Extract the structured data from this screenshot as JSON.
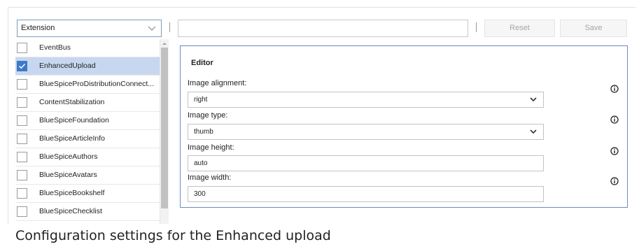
{
  "toolbar": {
    "filter_value": "Extension",
    "search_value": "",
    "reset_label": "Reset",
    "save_label": "Save"
  },
  "extensions": [
    {
      "label": "EventBus",
      "checked": false
    },
    {
      "label": "EnhancedUpload",
      "checked": true
    },
    {
      "label": "BlueSpiceProDistributionConnect...",
      "checked": false
    },
    {
      "label": "ContentStabilization",
      "checked": false
    },
    {
      "label": "BlueSpiceFoundation",
      "checked": false
    },
    {
      "label": "BlueSpiceArticleInfo",
      "checked": false
    },
    {
      "label": "BlueSpiceAuthors",
      "checked": false
    },
    {
      "label": "BlueSpiceAvatars",
      "checked": false
    },
    {
      "label": "BlueSpiceBookshelf",
      "checked": false
    },
    {
      "label": "BlueSpiceChecklist",
      "checked": false
    }
  ],
  "editor": {
    "title": "Editor",
    "fields": [
      {
        "label": "Image alignment:",
        "value": "right",
        "type": "dropdown"
      },
      {
        "label": "Image type:",
        "value": "thumb",
        "type": "dropdown"
      },
      {
        "label": "Image height:",
        "value": "auto",
        "type": "text"
      },
      {
        "label": "Image width:",
        "value": "300",
        "type": "text"
      }
    ]
  },
  "caption": "Configuration settings for the Enhanced upload",
  "colors": {
    "selected_row": "#c8d7f0",
    "checkbox_checked": "#3d79c9",
    "editor_border": "#6b8bbd"
  },
  "icons": {
    "dropdown": "chevron-down-icon",
    "info": "info-icon",
    "check": "checkmark-icon"
  }
}
